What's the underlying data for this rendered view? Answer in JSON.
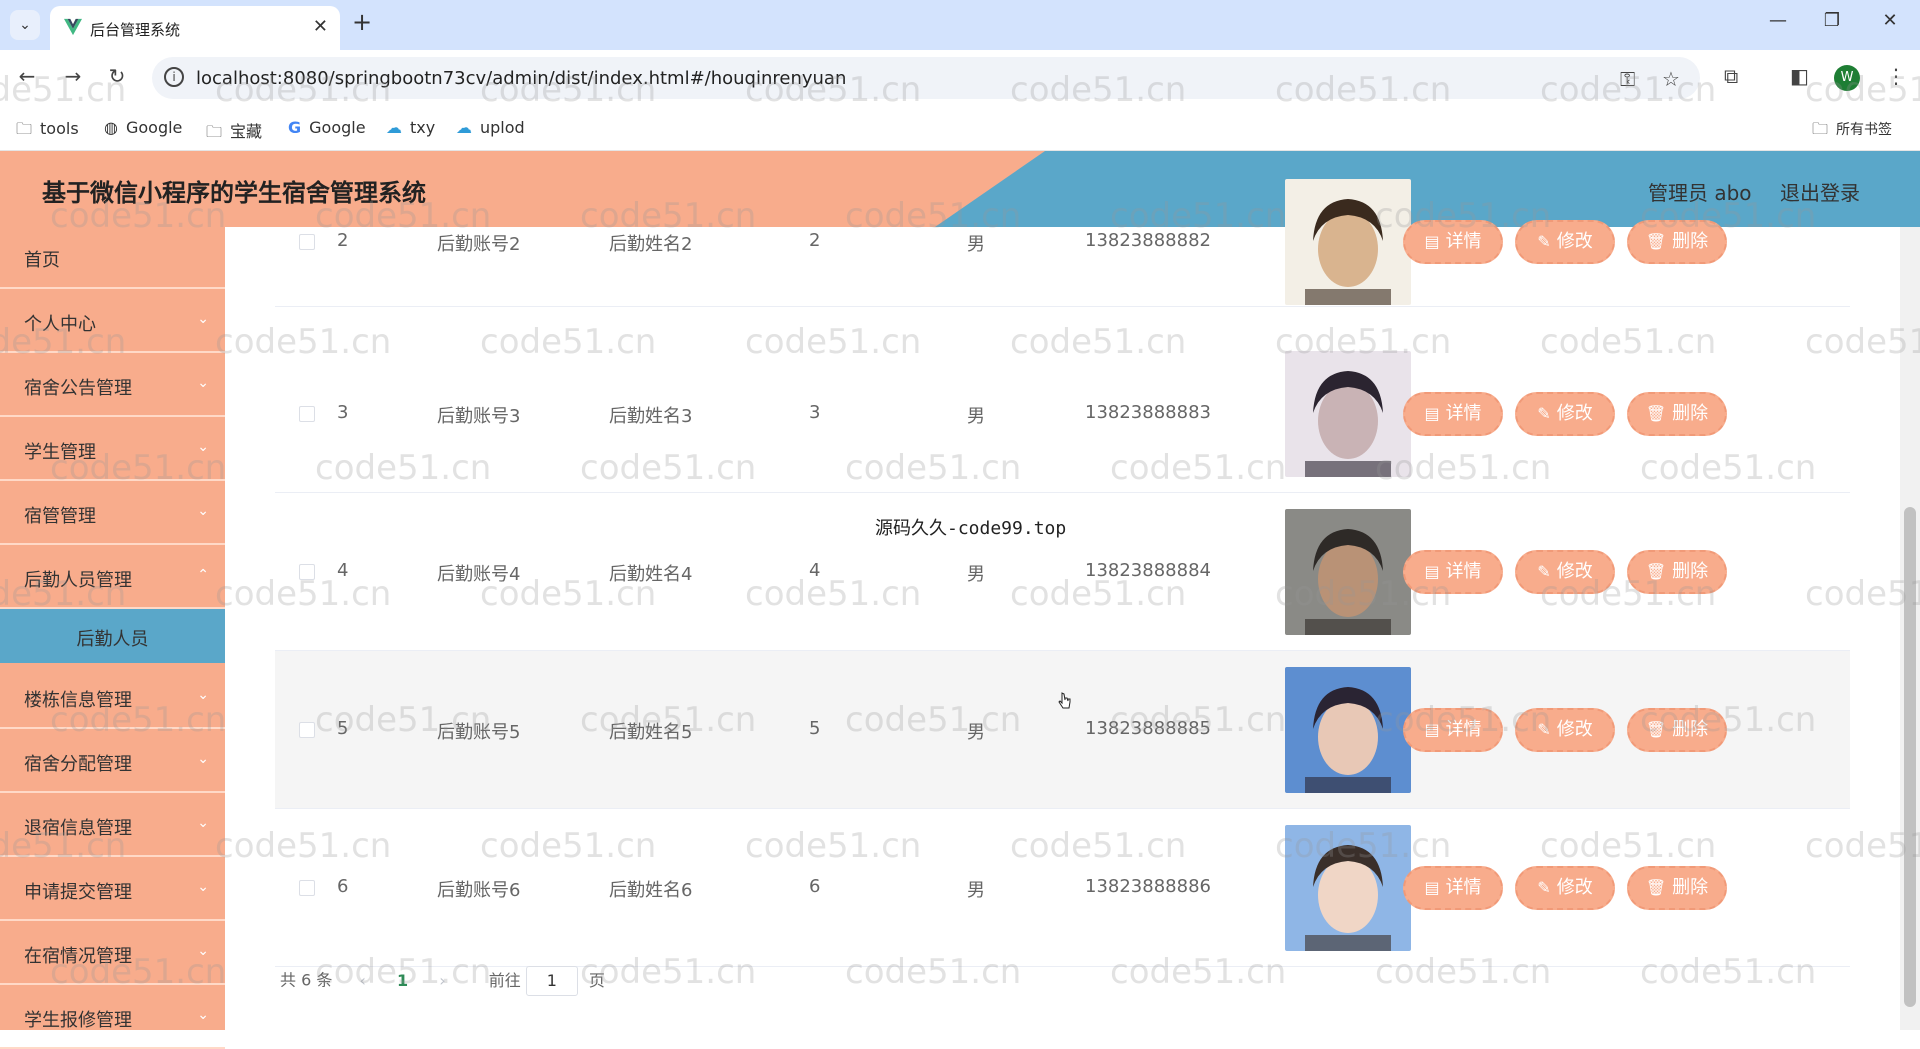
{
  "browser": {
    "tab_title": "后台管理系统",
    "url": "localhost:8080/springbootn73cv/admin/dist/index.html#/houqinrenyuan",
    "profile_initial": "W",
    "bookmarks": [
      {
        "label": "tools",
        "icon": "folder-icon"
      },
      {
        "label": "Google",
        "icon": "globe-icon"
      },
      {
        "label": "宝藏",
        "icon": "folder-icon"
      },
      {
        "label": "Google",
        "icon": "google-icon"
      },
      {
        "label": "txy",
        "icon": "cloud-icon"
      },
      {
        "label": "uplod",
        "icon": "cloud-icon"
      }
    ],
    "all_bookmarks": "所有书签"
  },
  "header": {
    "title": "基于微信小程序的学生宿舍管理系统",
    "user": "管理员 abo",
    "logout": "退出登录",
    "colors": {
      "primary": "#f8ac8c",
      "accent": "#5aa7c9"
    }
  },
  "sidebar": {
    "items": [
      {
        "label": "首页",
        "has_children": false
      },
      {
        "label": "个人中心",
        "has_children": true
      },
      {
        "label": "宿舍公告管理",
        "has_children": true
      },
      {
        "label": "学生管理",
        "has_children": true
      },
      {
        "label": "宿管管理",
        "has_children": true
      },
      {
        "label": "后勤人员管理",
        "has_children": true
      }
    ],
    "active_sub": "后勤人员",
    "items_after": [
      {
        "label": "楼栋信息管理"
      },
      {
        "label": "宿舍分配管理"
      },
      {
        "label": "退宿信息管理"
      },
      {
        "label": "申请提交管理"
      },
      {
        "label": "在宿情况管理"
      },
      {
        "label": "学生报修管理"
      }
    ]
  },
  "table": {
    "rows": [
      {
        "index": "2",
        "account": "后勤账号2",
        "name": "后勤姓名2",
        "age": "2",
        "gender": "男",
        "phone": "13823888882"
      },
      {
        "index": "3",
        "account": "后勤账号3",
        "name": "后勤姓名3",
        "age": "3",
        "gender": "男",
        "phone": "13823888883"
      },
      {
        "index": "4",
        "account": "后勤账号4",
        "name": "后勤姓名4",
        "age": "4",
        "gender": "男",
        "phone": "13823888884"
      },
      {
        "index": "5",
        "account": "后勤账号5",
        "name": "后勤姓名5",
        "age": "5",
        "gender": "男",
        "phone": "13823888885"
      },
      {
        "index": "6",
        "account": "后勤账号6",
        "name": "后勤姓名6",
        "age": "6",
        "gender": "男",
        "phone": "13823888886"
      }
    ],
    "actions": {
      "detail": "详情",
      "edit": "修改",
      "delete": "删除"
    }
  },
  "overlay_text": "源码久久-code99.top",
  "pagination": {
    "total": "共 6 条",
    "current_page": "1",
    "goto_prefix": "前往",
    "goto_value": "1",
    "goto_suffix": "页"
  },
  "watermark": "code51.cn"
}
